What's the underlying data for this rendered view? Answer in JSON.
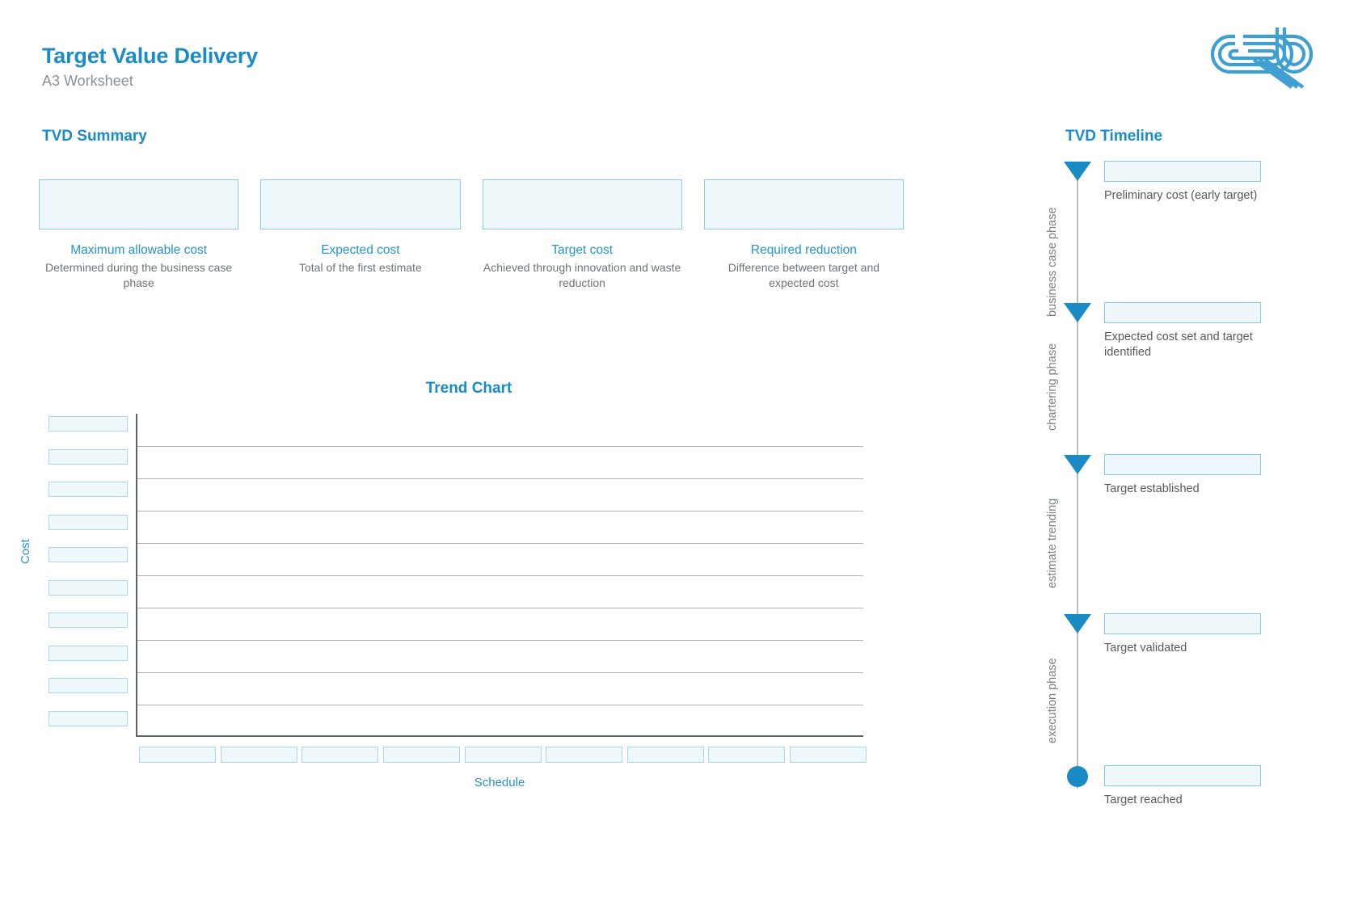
{
  "header": {
    "title": "Target Value Delivery",
    "subtitle": "A3 Worksheet",
    "logo_name": "crb-logo"
  },
  "colors": {
    "brand_blue": "#1b8bc6",
    "label_blue": "#2594c9",
    "field_fill": "#eef8fb",
    "field_border": "#8fcbe0",
    "body_gray": "#6d7275",
    "grid_gray": "#b0b3b6"
  },
  "summary": {
    "heading": "TVD Summary",
    "cells": [
      {
        "label": "Maximum allowable cost",
        "description": "Determined during the business case phase",
        "value": ""
      },
      {
        "label": "Expected cost",
        "description": "Total of the first estimate",
        "value": ""
      },
      {
        "label": "Target cost",
        "description": "Achieved through innovation and waste reduction",
        "value": ""
      },
      {
        "label": "Required reduction",
        "description": "Difference between target and expected cost",
        "value": ""
      }
    ]
  },
  "chart_data": {
    "type": "line",
    "title": "Trend Chart",
    "xlabel": "Schedule",
    "ylabel": "Cost",
    "grid": true,
    "legend": null,
    "series": [],
    "x_tick_values": [
      "",
      "",
      "",
      "",
      "",
      "",
      "",
      "",
      ""
    ],
    "y_tick_values": [
      "",
      "",
      "",
      "",
      "",
      "",
      "",
      "",
      "",
      ""
    ],
    "x_tick_count": 9,
    "y_tick_count": 10,
    "gridline_count": 9,
    "note": "Blank worksheet template: axis tick labels and data series are user-fillable input fields and are empty."
  },
  "timeline": {
    "heading": "TVD Timeline",
    "phases": [
      {
        "label": "business case phase"
      },
      {
        "label": "chartering phase"
      },
      {
        "label": "estimate trending"
      },
      {
        "label": "execution phase"
      }
    ],
    "milestones": [
      {
        "marker": "triangle-marker",
        "label": "Preliminary cost (early target)",
        "value": ""
      },
      {
        "marker": "triangle-marker",
        "label": "Expected cost set and target identified",
        "value": ""
      },
      {
        "marker": "triangle-marker",
        "label": "Target established",
        "value": ""
      },
      {
        "marker": "triangle-marker",
        "label": "Target validated",
        "value": ""
      },
      {
        "marker": "circle-marker",
        "label": "Target reached",
        "value": ""
      }
    ]
  }
}
